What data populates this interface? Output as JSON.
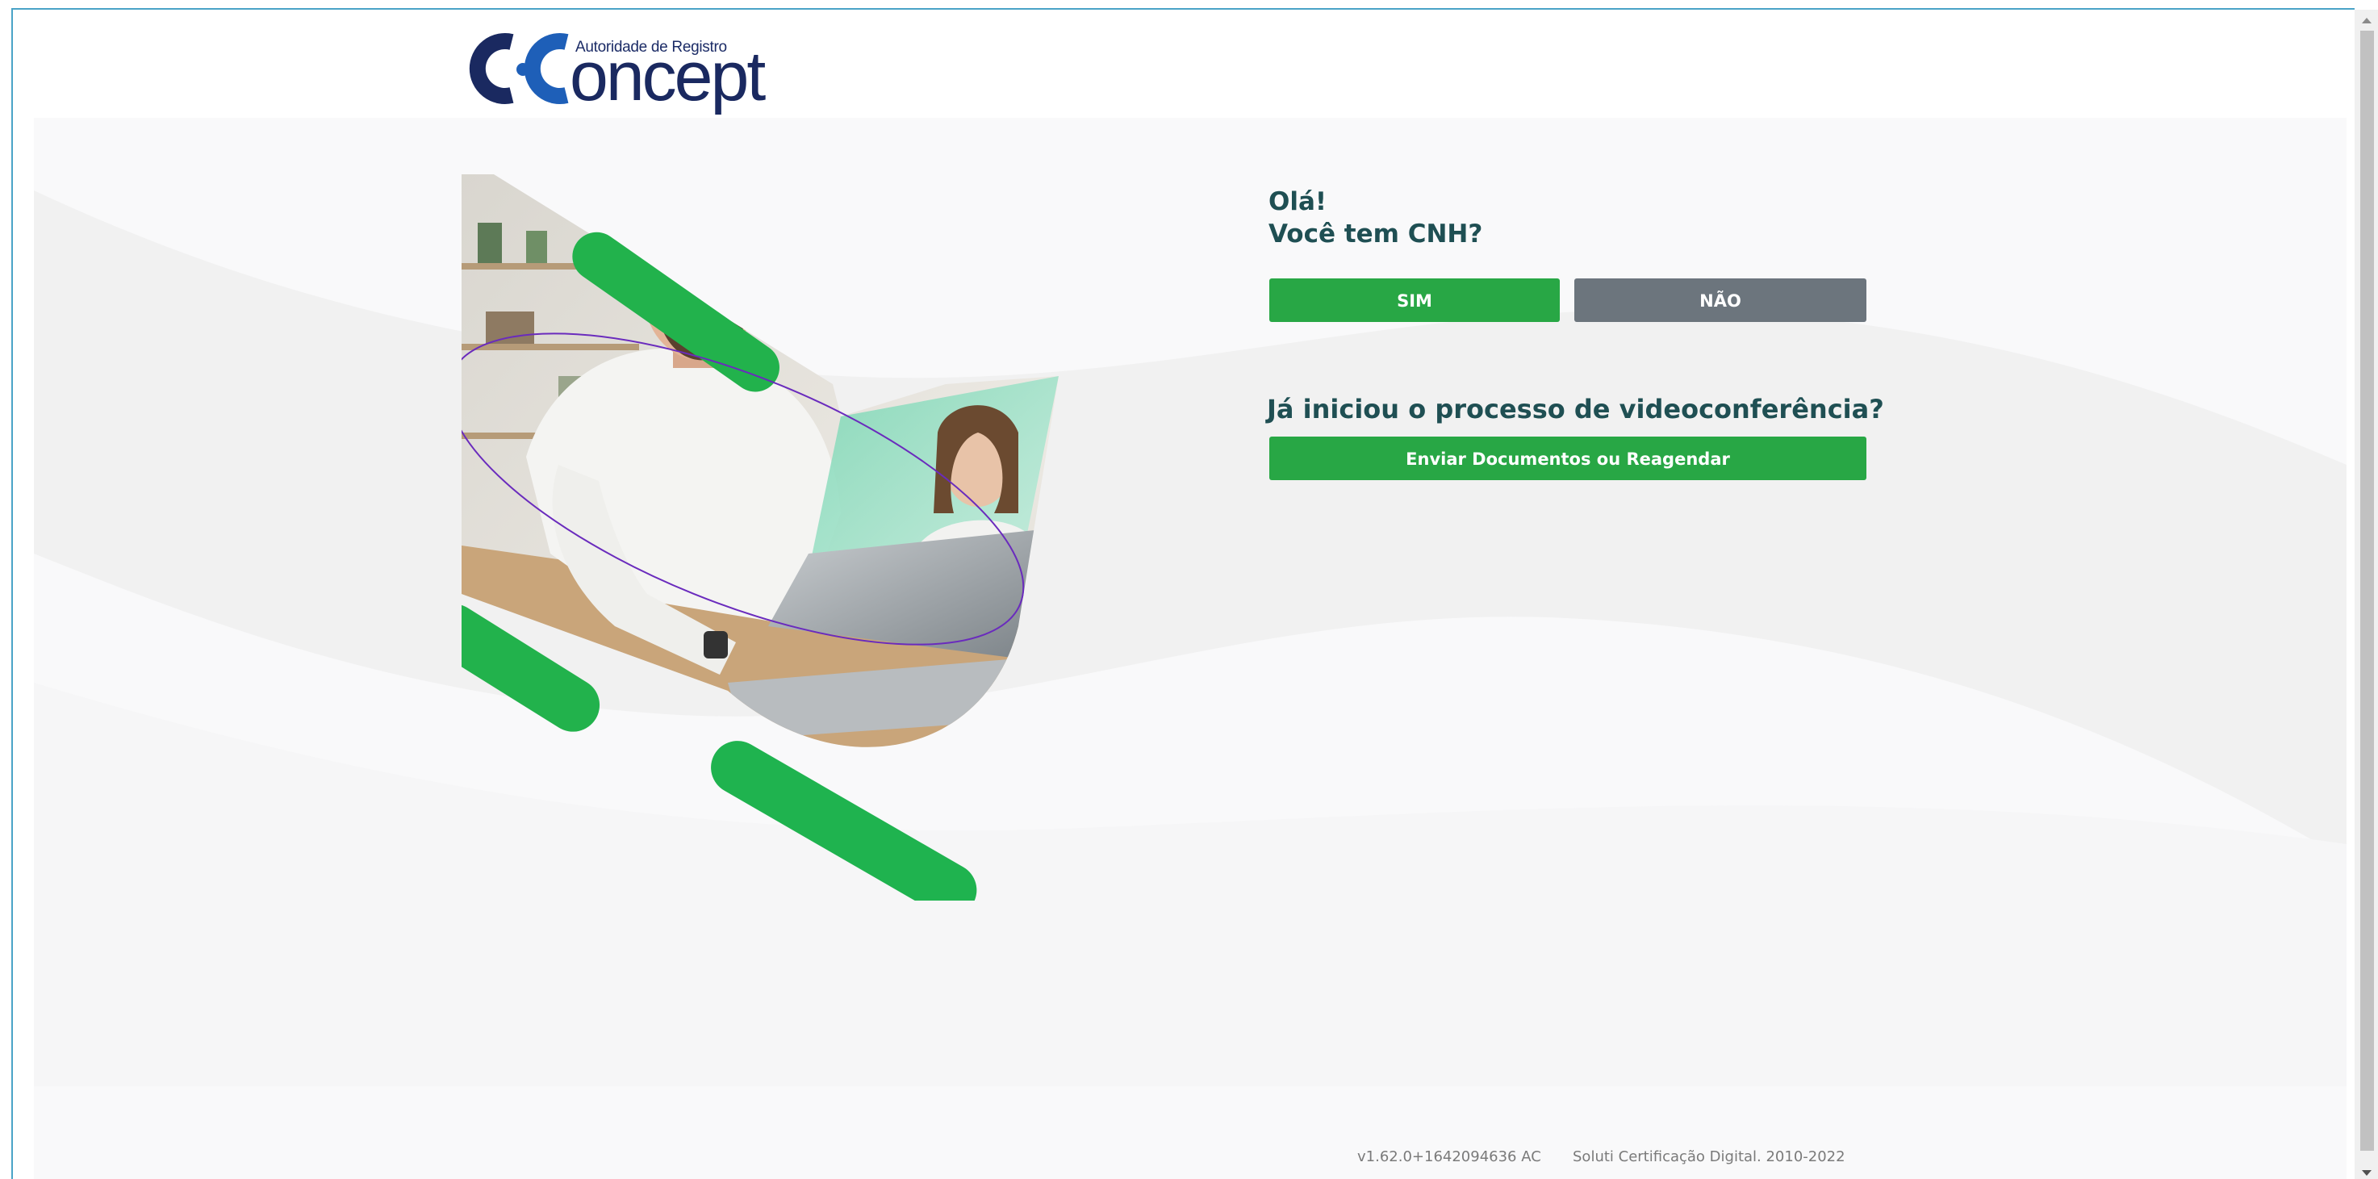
{
  "header": {
    "logo": {
      "caption": "Autoridade de Registro",
      "wordmark": "oncept",
      "initials": "C·C"
    }
  },
  "main": {
    "greeting_line1": "Olá!",
    "greeting_line2": "Você tem CNH?",
    "sim_label": "SIM",
    "nao_label": "NÃO",
    "question2": "Já iniciou o processo de videoconferência?",
    "enviar_label": "Enviar Documentos ou Reagendar"
  },
  "footer": {
    "version": "v1.62.0+1642094636 AC",
    "copyright": "Soluti Certificação Digital. 2010-2022"
  },
  "colors": {
    "primary_green": "#28a745",
    "secondary_gray": "#6c757d",
    "heading_teal": "#1f4f53",
    "logo_navy": "#1a2960",
    "logo_blue": "#1e5fb8"
  }
}
